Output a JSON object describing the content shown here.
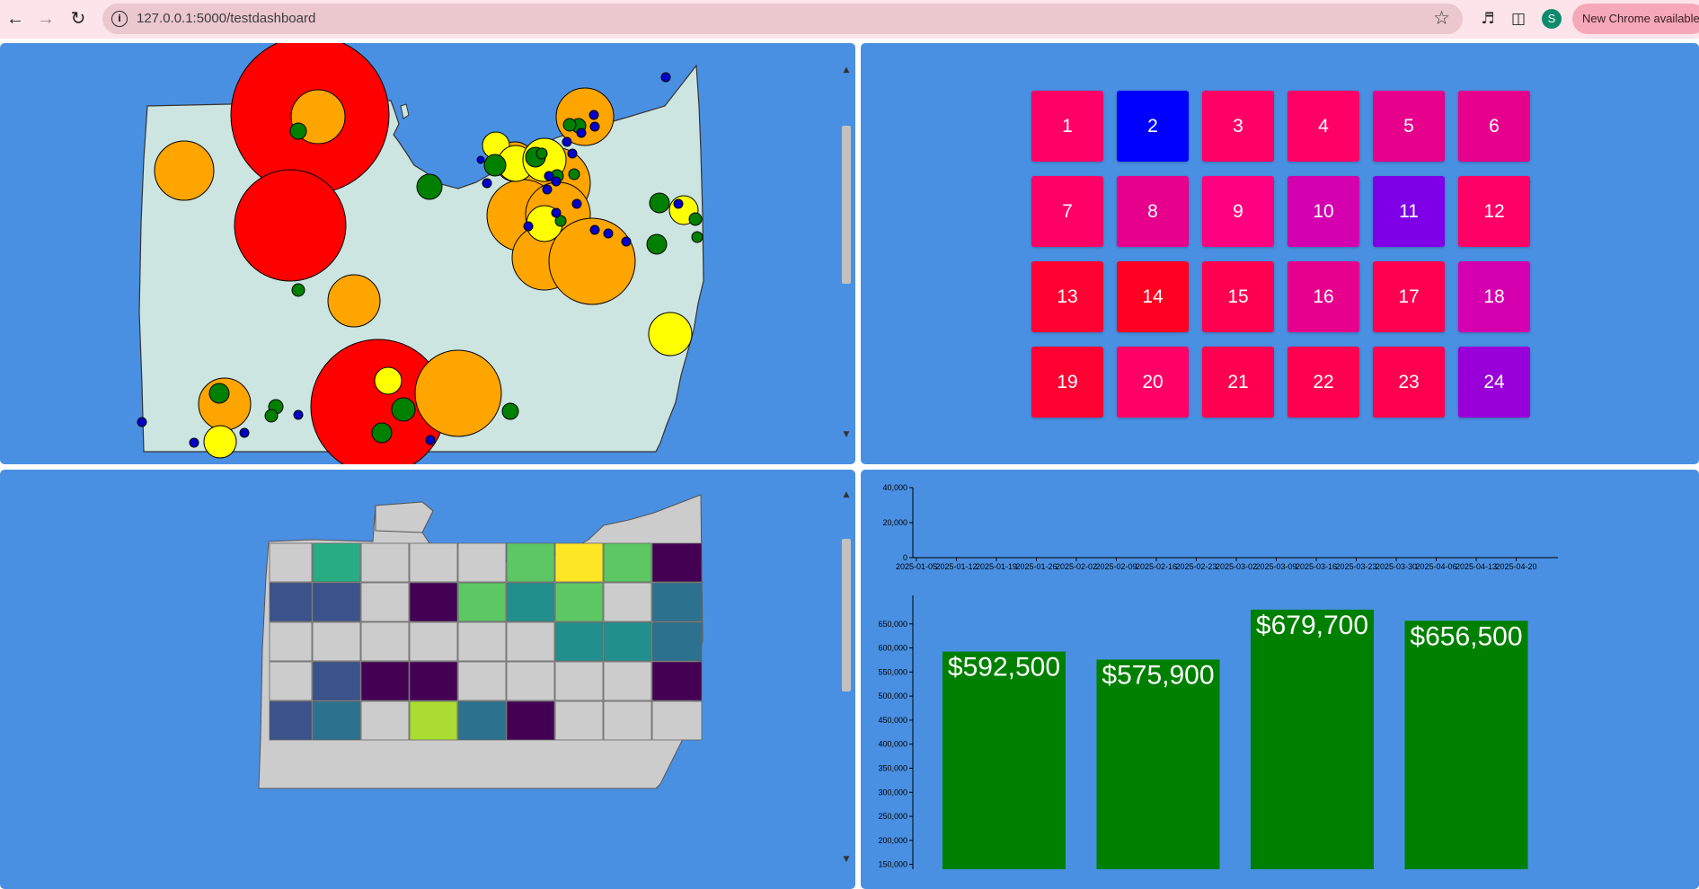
{
  "browser": {
    "url": "127.0.0.1:5000/testdashboard",
    "avatar_initial": "S",
    "update_label": "New Chrome available",
    "icons": {
      "back": "back-arrow-icon",
      "forward": "forward-arrow-icon",
      "reload": "reload-icon",
      "site_info": "site-info-icon",
      "bookmark": "star-icon",
      "media": "media-control-icon",
      "side_panel": "side-panel-icon"
    }
  },
  "tiles": {
    "labels": [
      "1",
      "2",
      "3",
      "4",
      "5",
      "6",
      "7",
      "8",
      "9",
      "10",
      "11",
      "12",
      "13",
      "14",
      "15",
      "16",
      "17",
      "18",
      "19",
      "20",
      "21",
      "22",
      "23",
      "24"
    ],
    "colors": [
      "#ff0066",
      "#0000ff",
      "#ff0066",
      "#ff0066",
      "#e6008c",
      "#e6008c",
      "#ff0066",
      "#e6008c",
      "#ff0080",
      "#d400b0",
      "#7f00e6",
      "#ff0066",
      "#ff0033",
      "#ff0022",
      "#ff0050",
      "#e6008c",
      "#ff0050",
      "#d400b0",
      "#ff0033",
      "#ff0066",
      "#ff0050",
      "#ff0050",
      "#ff0050",
      "#9900d9"
    ]
  },
  "bubble_map": {
    "land_color": "#cce5e0",
    "legend_colors": [
      "#ff0000",
      "#ffa500",
      "#ffff00",
      "#008000",
      "#0000cc"
    ]
  },
  "choropleth": {
    "colors": {
      "none": "#cccccc",
      "dark_purple": "#440154",
      "indigo": "#3b528b",
      "teal": "#2c728e",
      "teal_green": "#21908d",
      "green": "#27ad81",
      "light_green": "#5dc863",
      "lime": "#aadc32",
      "yellow": "#fde725"
    }
  },
  "chart_data": [
    {
      "type": "line",
      "title": "",
      "xlabel": "",
      "ylabel": "",
      "x_ticks": [
        "2025-01-05",
        "2025-01-12",
        "2025-01-19",
        "2025-01-26",
        "2025-02-02",
        "2025-02-09",
        "2025-02-16",
        "2025-02-23",
        "2025-03-02",
        "2025-03-09",
        "2025-03-16",
        "2025-03-23",
        "2025-03-30",
        "2025-04-06",
        "2025-04-13",
        "2025-04-20"
      ],
      "y_ticks": [
        "0",
        "20,000",
        "40,000"
      ],
      "ylim": [
        0,
        40000
      ],
      "series": []
    },
    {
      "type": "bar",
      "title": "",
      "xlabel": "",
      "ylabel": "",
      "categories": [
        "",
        "",
        "",
        ""
      ],
      "values": [
        592500,
        575900,
        679700,
        656500
      ],
      "value_labels": [
        "$592,500",
        "$575,900",
        "$679,700",
        "$656,500"
      ],
      "y_ticks": [
        "150,000",
        "200,000",
        "250,000",
        "300,000",
        "350,000",
        "400,000",
        "450,000",
        "500,000",
        "550,000",
        "600,000",
        "650,000"
      ],
      "ylim": [
        140000,
        700000
      ],
      "bar_color": "#008000",
      "grid": false
    }
  ]
}
